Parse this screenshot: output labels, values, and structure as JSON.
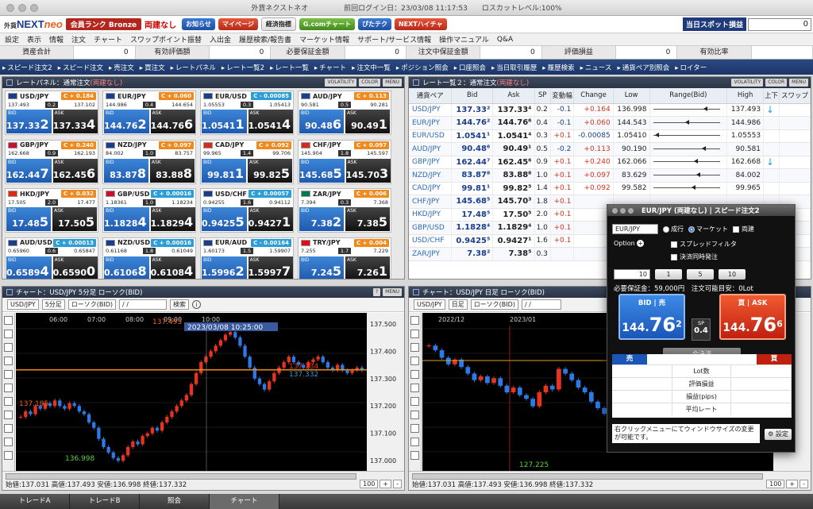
{
  "window": {
    "title": "外貨ネクストネオ",
    "last_login": "前回ログイン日：23/03/08 11:17:53",
    "losscut": "ロスカットレベル:100%"
  },
  "header": {
    "logo_prefix": "外貨",
    "logo_main": "NEXT",
    "logo_neo": "neo",
    "rank_label": "会員ランク Bronze",
    "ryodate": "両建なし",
    "buttons": [
      "お知らせ",
      "マイページ",
      "経済指標",
      "G.comチャート",
      "ぴたテク",
      "NEXTハイチャ"
    ],
    "spot_label": "当日スポット損益",
    "spot_value": "0"
  },
  "menu": [
    "設定",
    "表示",
    "情報",
    "注文",
    "チャート",
    "スワップポイント振替",
    "入出金",
    "履歴検索/報告書",
    "マーケット情報",
    "サポート/サービス情報",
    "操作マニュアル",
    "Q&A"
  ],
  "status": [
    {
      "k": "資産合計",
      "v": "0"
    },
    {
      "k": "有効評価額",
      "v": "0"
    },
    {
      "k": "必要保証金額",
      "v": "0"
    },
    {
      "k": "注文中保証金額",
      "v": "0"
    },
    {
      "k": "評価損益",
      "v": "0"
    },
    {
      "k": "有効比率",
      "v": ""
    }
  ],
  "toolbar": [
    "スピード注文2",
    "スピード注文",
    "売注文",
    "買注文",
    "レートパネル",
    "レート一覧2",
    "レート一覧",
    "チャート",
    "注文中一覧",
    "ポジション照会",
    "口座照会",
    "当日取引履歴",
    "履歴検索",
    "ニュース",
    "通貨ペア別照会",
    "ロイター"
  ],
  "rate_panel": {
    "title": "レートパネル：通常注文",
    "suffix": "(両建なし)",
    "controls": [
      "VOLATILITY",
      "COLOR",
      "MENU"
    ],
    "tiles": [
      {
        "pair": "USD/JPY",
        "chg": "C + 0.184",
        "dir": "up",
        "h": "137.493",
        "spr": "0.2",
        "l": "137.102",
        "bid_a": "137.33",
        "bid_b": "2",
        "ask_a": "137.33",
        "ask_b": "4",
        "flag": "#1b3e8c"
      },
      {
        "pair": "EUR/JPY",
        "chg": "C + 0.060",
        "dir": "up",
        "h": "144.986",
        "spr": "0.4",
        "l": "144.654",
        "bid_a": "144.76",
        "bid_b": "2",
        "ask_a": "144.76",
        "ask_b": "6",
        "flag": "#1b3e8c"
      },
      {
        "pair": "EUR/USD",
        "chg": "C - 0.00085",
        "dir": "dn",
        "h": "1.05553",
        "spr": "0.3",
        "l": "1.05413",
        "bid_a": "1.0541",
        "bid_b": "1",
        "ask_a": "1.0541",
        "ask_b": "4",
        "flag": "#1b3e8c"
      },
      {
        "pair": "AUD/JPY",
        "chg": "C + 0.113",
        "dir": "up",
        "h": "90.581",
        "spr": "0.5",
        "l": "90.281",
        "bid_a": "90.48",
        "bid_b": "6",
        "ask_a": "90.49",
        "ask_b": "1",
        "flag": "#1b3e8c"
      },
      {
        "pair": "GBP/JPY",
        "chg": "C + 0.240",
        "dir": "up",
        "h": "162.668",
        "spr": "0.9",
        "l": "162.193",
        "bid_a": "162.44",
        "bid_b": "7",
        "ask_a": "162.45",
        "ask_b": "6",
        "flag": "#c8102e"
      },
      {
        "pair": "NZD/JPY",
        "chg": "C + 0.097",
        "dir": "up",
        "h": "84.002",
        "spr": "1.0",
        "l": "83.757",
        "bid_a": "83.87",
        "bid_b": "8",
        "ask_a": "83.88",
        "ask_b": "8",
        "flag": "#1b3e8c"
      },
      {
        "pair": "CAD/JPY",
        "chg": "C + 0.092",
        "dir": "up",
        "h": "99.965",
        "spr": "1.4",
        "l": "99.706",
        "bid_a": "99.81",
        "bid_b": "1",
        "ask_a": "99.82",
        "ask_b": "5",
        "flag": "#d52b1e"
      },
      {
        "pair": "CHF/JPY",
        "chg": "C + 0.097",
        "dir": "up",
        "h": "145.904",
        "spr": "1.8",
        "l": "145.597",
        "bid_a": "145.68",
        "bid_b": "5",
        "ask_a": "145.70",
        "ask_b": "3",
        "flag": "#d52b1e"
      },
      {
        "pair": "HKD/JPY",
        "chg": "C + 0.032",
        "dir": "up",
        "h": "17.505",
        "spr": "2.0",
        "l": "17.477",
        "bid_a": "17.48",
        "bid_b": "5",
        "ask_a": "17.50",
        "ask_b": "5",
        "flag": "#de2910"
      },
      {
        "pair": "GBP/USD",
        "chg": "C + 0.00016",
        "dir": "dn",
        "h": "1.18361",
        "spr": "1.0",
        "l": "1.18234",
        "bid_a": "1.1828",
        "bid_b": "4",
        "ask_a": "1.1829",
        "ask_b": "4",
        "flag": "#c8102e"
      },
      {
        "pair": "USD/CHF",
        "chg": "C + 0.00057",
        "dir": "dn",
        "h": "0.94255",
        "spr": "1.6",
        "l": "0.94112",
        "bid_a": "0.9425",
        "bid_b": "5",
        "ask_a": "0.9427",
        "ask_b": "1",
        "flag": "#1b3e8c"
      },
      {
        "pair": "ZAR/JPY",
        "chg": "C + 0.006",
        "dir": "up",
        "h": "7.394",
        "spr": "0.3",
        "l": "7.368",
        "bid_a": "7.38",
        "bid_b": "2",
        "ask_a": "7.38",
        "ask_b": "5",
        "flag": "#007a4d"
      },
      {
        "pair": "AUD/USD",
        "chg": "C + 0.00013",
        "dir": "dn",
        "h": "0.65960",
        "spr": "0.6",
        "l": "0.65847",
        "bid_a": "0.6589",
        "bid_b": "4",
        "ask_a": "0.6590",
        "ask_b": "0",
        "flag": "#1b3e8c"
      },
      {
        "pair": "NZD/USD",
        "chg": "C + 0.00016",
        "dir": "dn",
        "h": "0.61168",
        "spr": "1.8",
        "l": "0.61049",
        "bid_a": "0.6106",
        "bid_b": "8",
        "ask_a": "0.6108",
        "ask_b": "4",
        "flag": "#1b3e8c"
      },
      {
        "pair": "EUR/AUD",
        "chg": "C - 0.00164",
        "dir": "dn",
        "h": "1.60173",
        "spr": "1.5",
        "l": "1.59907",
        "bid_a": "1.5996",
        "bid_b": "2",
        "ask_a": "1.5997",
        "ask_b": "7",
        "flag": "#1b3e8c"
      },
      {
        "pair": "TRY/JPY",
        "chg": "C + 0.004",
        "dir": "up",
        "h": "7.255",
        "spr": "1.7",
        "l": "7.229",
        "bid_a": "7.24",
        "bid_b": "5",
        "ask_a": "7.26",
        "ask_b": "1",
        "flag": "#e30a17"
      }
    ]
  },
  "rate_list": {
    "title": "レート一覧２：通常注文",
    "suffix": "(両建なし)",
    "columns": [
      "通貨ペア",
      "Bid",
      "Ask",
      "SP",
      "変動幅",
      "Change",
      "Low",
      "Range(Bid)",
      "High",
      "上下",
      "スワップ"
    ],
    "rows": [
      {
        "pair": "USD/JPY",
        "bid": "137.33²",
        "ask": "137.33⁴",
        "sp": "0.2",
        "var": "-0.1",
        "vsign": "neg",
        "chg": "+0.164",
        "csign": "pos",
        "low": "136.998",
        "high": "137.493",
        "pos": 0.78,
        "ud": "↓"
      },
      {
        "pair": "EUR/JPY",
        "bid": "144.76²",
        "ask": "144.76⁶",
        "sp": "0.4",
        "var": "-0.1",
        "vsign": "neg",
        "chg": "+0.060",
        "csign": "pos",
        "low": "144.543",
        "high": "144.986",
        "pos": 0.49,
        "ud": ""
      },
      {
        "pair": "EUR/USD",
        "bid": "1.0541¹",
        "ask": "1.0541⁴",
        "sp": "0.3",
        "var": "+0.1",
        "vsign": "pos",
        "chg": "-0.00085",
        "csign": "neg",
        "low": "1.05410",
        "high": "1.05553",
        "pos": 0.02,
        "ud": ""
      },
      {
        "pair": "AUD/JPY",
        "bid": "90.48⁶",
        "ask": "90.49¹",
        "sp": "0.5",
        "var": "-0.2",
        "vsign": "neg",
        "chg": "+0.113",
        "csign": "pos",
        "low": "90.190",
        "high": "90.581",
        "pos": 0.76,
        "ud": ""
      },
      {
        "pair": "GBP/JPY",
        "bid": "162.44⁷",
        "ask": "162.45⁶",
        "sp": "0.9",
        "var": "+0.1",
        "vsign": "pos",
        "chg": "+0.240",
        "csign": "pos",
        "low": "162.066",
        "high": "162.668",
        "pos": 0.63,
        "ud": "↓"
      },
      {
        "pair": "NZD/JPY",
        "bid": "83.87⁸",
        "ask": "83.88⁸",
        "sp": "1.0",
        "var": "+0.1",
        "vsign": "pos",
        "chg": "+0.097",
        "csign": "pos",
        "low": "83.629",
        "high": "84.002",
        "pos": 0.67,
        "ud": ""
      },
      {
        "pair": "CAD/JPY",
        "bid": "99.81¹",
        "ask": "99.82⁵",
        "sp": "1.4",
        "var": "+0.1",
        "vsign": "pos",
        "chg": "+0.092",
        "csign": "pos",
        "low": "99.582",
        "high": "99.965",
        "pos": 0.6,
        "ud": ""
      },
      {
        "pair": "CHF/JPY",
        "bid": "145.68⁵",
        "ask": "145.70³",
        "sp": "1.8",
        "var": "+0.1",
        "vsign": "pos",
        "chg": "",
        "csign": "pos",
        "low": "",
        "high": "",
        "pos": 0.5,
        "ud": ""
      },
      {
        "pair": "HKD/JPY",
        "bid": "17.48⁵",
        "ask": "17.50⁵",
        "sp": "2.0",
        "var": "+0.1",
        "vsign": "pos",
        "chg": "",
        "csign": "pos",
        "low": "",
        "high": "",
        "pos": 0.5,
        "ud": ""
      },
      {
        "pair": "GBP/USD",
        "bid": "1.1828⁴",
        "ask": "1.1829⁴",
        "sp": "1.0",
        "var": "+0.1",
        "vsign": "pos",
        "chg": "",
        "csign": "pos",
        "low": "",
        "high": "",
        "pos": 0.5,
        "ud": ""
      },
      {
        "pair": "USD/CHF",
        "bid": "0.9425⁵",
        "ask": "0.9427¹",
        "sp": "1.6",
        "var": "+0.1",
        "vsign": "pos",
        "chg": "",
        "csign": "pos",
        "low": "",
        "high": "",
        "pos": 0.5,
        "ud": ""
      },
      {
        "pair": "ZAR/JPY",
        "bid": "7.38²",
        "ask": "7.38⁵",
        "sp": "0.3",
        "var": "",
        "vsign": "pos",
        "chg": "",
        "csign": "pos",
        "low": "",
        "high": "",
        "pos": 0.5,
        "ud": ""
      }
    ]
  },
  "chart1": {
    "title": "チャート：USD/JPY 5分足 ローソク(BID)",
    "pair": "USD/JPY",
    "tf": "5分足",
    "type": "ローソク(BID)",
    "date": "/ /",
    "search": "検索",
    "cursor_label": "2023/03/08 10:25:00",
    "footer": "始値:137.031  高値:137.493  安値:136.998  終値:137.332",
    "zoom": "100",
    "chart_data": {
      "type": "candlestick",
      "xlabels": [
        "06:00",
        "07:00",
        "08:00",
        "09:00",
        "10:00"
      ],
      "ylabels": [
        "137.500",
        "137.400",
        "137.300",
        "137.200",
        "137.100",
        "137.000"
      ],
      "ylim": [
        136.96,
        137.54
      ],
      "annotations": {
        "high": "137.493",
        "low": "136.998",
        "left": "137.195",
        "ask": "137.334",
        "bid": "137.332"
      },
      "closes": [
        137.16,
        137.18,
        137.17,
        137.2,
        137.19,
        137.21,
        137.2,
        137.22,
        137.2,
        137.19,
        137.21,
        137.2,
        137.18,
        137.17,
        137.14,
        137.12,
        137.08,
        137.05,
        137.03,
        137.01,
        137.0,
        137.02,
        137.05,
        137.07,
        137.06,
        137.09,
        137.1,
        137.12,
        137.11,
        137.14,
        137.16,
        137.18,
        137.2,
        137.22,
        137.24,
        137.28,
        137.32,
        137.36,
        137.38,
        137.4,
        137.42,
        137.44,
        137.46,
        137.47,
        137.45,
        137.42,
        137.38,
        137.34,
        137.3,
        137.28,
        137.26,
        137.29,
        137.32,
        137.34,
        137.36,
        137.38,
        137.36,
        137.35,
        137.34,
        137.36,
        137.37,
        137.38,
        137.36,
        137.34,
        137.33,
        137.35,
        137.33,
        137.32,
        137.33,
        137.34,
        137.33
      ]
    }
  },
  "chart2": {
    "title": "チャート：USD/JPY 日足 ローソク(BID)",
    "pair": "USD/JPY",
    "tf": "日足",
    "type": "ローソク(BID)",
    "date": "/ /",
    "search": "検索",
    "footer": "始値:137.031  高値:137.493  安値:136.998  終値:137.332",
    "zoom": "100",
    "chart_data": {
      "type": "candlestick",
      "xlabels": [
        "2022/12",
        "2023/01"
      ],
      "ylim": [
        125,
        142
      ],
      "annotations": {
        "low": "127.225"
      },
      "closes": [
        138.5,
        138.0,
        137.2,
        136.5,
        137.0,
        136.2,
        135.5,
        134.8,
        135.2,
        134.5,
        135.0,
        134.2,
        133.5,
        134.0,
        133.2,
        132.8,
        132.0,
        133.5,
        134.2,
        133.8,
        136.0,
        135.5,
        134.8,
        134.0,
        133.5,
        132.5,
        131.8,
        131.2,
        130.8,
        131.5,
        130.5,
        129.8,
        131.0,
        131.8,
        130.8,
        130.2,
        129.5,
        128.8,
        128.2,
        129.0,
        128.5,
        128.8,
        129.6,
        130.2,
        130.8,
        131.2,
        130.6,
        130.0,
        129.4,
        128.6,
        130.2,
        131.0,
        131.6
      ]
    }
  },
  "speed_order": {
    "title": "EUR/JPY (両建なし) | スピード注文2",
    "pair": "EUR/JPY",
    "opt1": "成行",
    "opt2": "マーケット",
    "ryodate": "両建",
    "option": "Option",
    "spread_filter": "スプレッドフィルタ",
    "settle": "決済同時発注",
    "qty": "10",
    "q1": "1",
    "q2": "5",
    "q3": "10",
    "margin": "必要保証金：59,000円",
    "avail": "注文可能目安：0Lot",
    "bid_label": "BID | 売",
    "ask_label": "買 | ASK",
    "bid_a": "144.",
    "bid_b": "76",
    "bid_c": "2",
    "ask_a": "144.",
    "ask_b": "76",
    "ask_c": "6",
    "sp_label": "SP",
    "sp_value": "0.4",
    "settle_all": "全決済",
    "sell": "売",
    "buy": "買",
    "rows": [
      "Lot数",
      "評価損益",
      "損益(pips)",
      "平均レート"
    ],
    "note": "右クリックメニューにてウィンドウサイズの変更が可能です。",
    "settings": "設定"
  },
  "bottom_tabs": [
    "トレードA",
    "トレードB",
    "照会",
    "チャート"
  ]
}
